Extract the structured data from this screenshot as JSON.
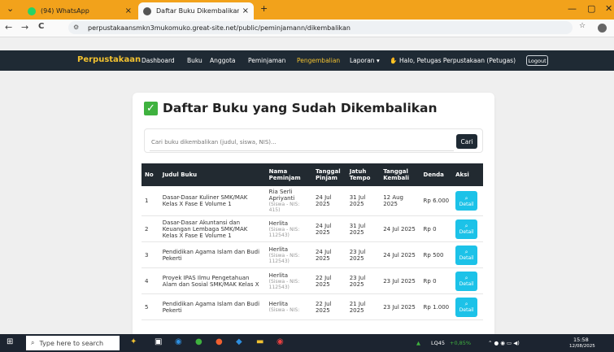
{
  "browser": {
    "tabs": [
      {
        "title": "(94) WhatsApp",
        "close": "×"
      },
      {
        "title": "Daftar Buku Dikembalikan",
        "close": "×"
      }
    ],
    "new_tab": "+",
    "url": "perpustakaansmkn3mukomuko.great-site.net/public/peminjamann/dikembalikan",
    "window_controls": [
      "—",
      "▢",
      "✕"
    ],
    "nav": [
      "←",
      "→",
      "C"
    ]
  },
  "navbar": {
    "brand": "Perpustakaan",
    "items": [
      "Dashboard",
      "Buku",
      "Anggota",
      "Peminjaman",
      "Pengembalian",
      "Laporan ▾"
    ],
    "active_item": "Pengembalian",
    "greeting": "Halo, Petugas Perpustakaan (Petugas)",
    "logout": "Logout"
  },
  "page": {
    "title": "Daftar Buku yang Sudah Dikembalikan",
    "search_placeholder": "Cari buku dikembalikan (judul, siswa, NIS)...",
    "search_button": "Cari",
    "columns": [
      "No",
      "Judul Buku",
      "Nama Peminjam",
      "Tanggal Pinjam",
      "Jatuh Tempo",
      "Tanggal Kembali",
      "Denda",
      "Aksi"
    ],
    "detail_label": "Detail",
    "rows": [
      {
        "no": "1",
        "judul": "Dasar-Dasar Kuliner SMK/MAK Kelas X Fase E Volume 1",
        "nama": "Ria Serli Apriyanti",
        "nis": "(Siswa - NIS: 415)",
        "pinjam": "24 Jul 2025",
        "tempo": "31 Jul 2025",
        "kembali": "12 Aug 2025",
        "denda": "Rp 6.000"
      },
      {
        "no": "2",
        "judul": "Dasar-Dasar Akuntansi dan Keuangan Lembaga SMK/MAK Kelas X Fase E Volume 1",
        "nama": "Herlita",
        "nis": "(Siswa - NIS: 112543)",
        "pinjam": "24 Jul 2025",
        "tempo": "31 Jul 2025",
        "kembali": "24 Jul 2025",
        "denda": "Rp 0"
      },
      {
        "no": "3",
        "judul": "Pendidikan Agama Islam dan Budi Pekerti",
        "nama": "Herlita",
        "nis": "(Siswa - NIS: 112543)",
        "pinjam": "24 Jul 2025",
        "tempo": "23 Jul 2025",
        "kembali": "24 Jul 2025",
        "denda": "Rp 500"
      },
      {
        "no": "4",
        "judul": "Proyek IPAS Ilmu Pengetahuan Alam dan Sosial SMK/MAK Kelas X",
        "nama": "Herlita",
        "nis": "(Siswa - NIS: 112543)",
        "pinjam": "22 Jul 2025",
        "tempo": "23 Jul 2025",
        "kembali": "23 Jul 2025",
        "denda": "Rp 0"
      },
      {
        "no": "5",
        "judul": "Pendidikan Agama Islam dan Budi Pekerti",
        "nama": "Herlita",
        "nis": "(Siswa - NIS:",
        "pinjam": "22 Jul 2025",
        "tempo": "21 Jul 2025",
        "kembali": "23 Jul 2025",
        "denda": "Rp 1.000"
      }
    ]
  },
  "taskbar": {
    "search_placeholder": "Type here to search",
    "stock": "LQ45",
    "stock_change": "+0,85%",
    "time": "15:58",
    "date": "12/08/2025"
  },
  "colors": {
    "accent": "#f2a21b",
    "brand": "#f2c230",
    "navbar": "#1f2a34",
    "detail": "#1cc2e8",
    "check": "#3fb23f"
  }
}
